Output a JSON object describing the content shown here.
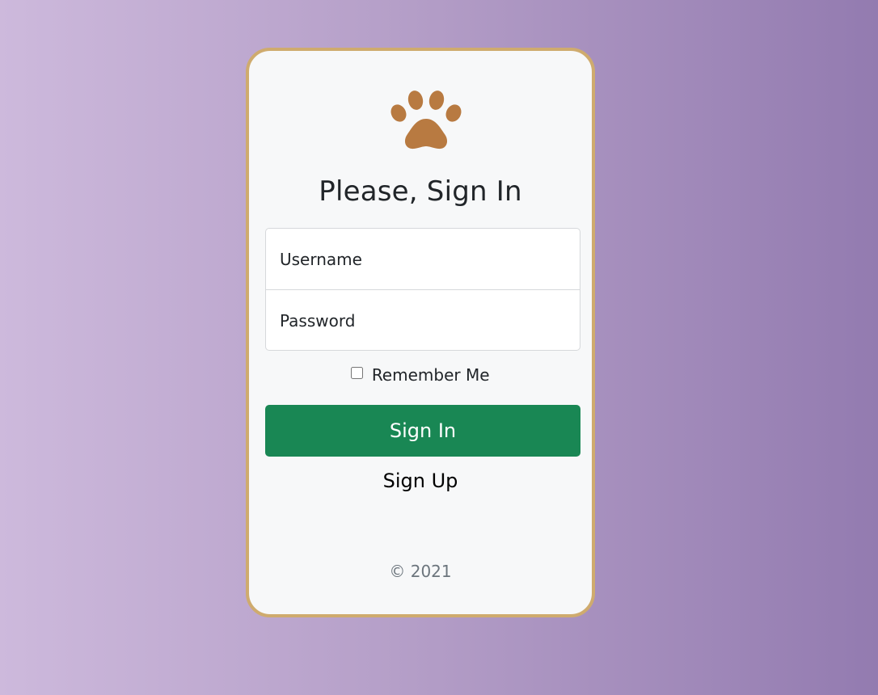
{
  "form": {
    "logo_icon": "paw-icon",
    "title": "Please, Sign In",
    "username_placeholder": "Username",
    "password_placeholder": "Password",
    "remember_label": "Remember Me",
    "remember_checked": false,
    "signin_label": "Sign In",
    "signup_label": "Sign Up",
    "copyright": "© 2021"
  },
  "colors": {
    "card_border": "#cfab6e",
    "paw": "#b87a41",
    "primary_button": "#198754",
    "background_start": "#cdb9dc",
    "background_end": "#937bb0"
  }
}
